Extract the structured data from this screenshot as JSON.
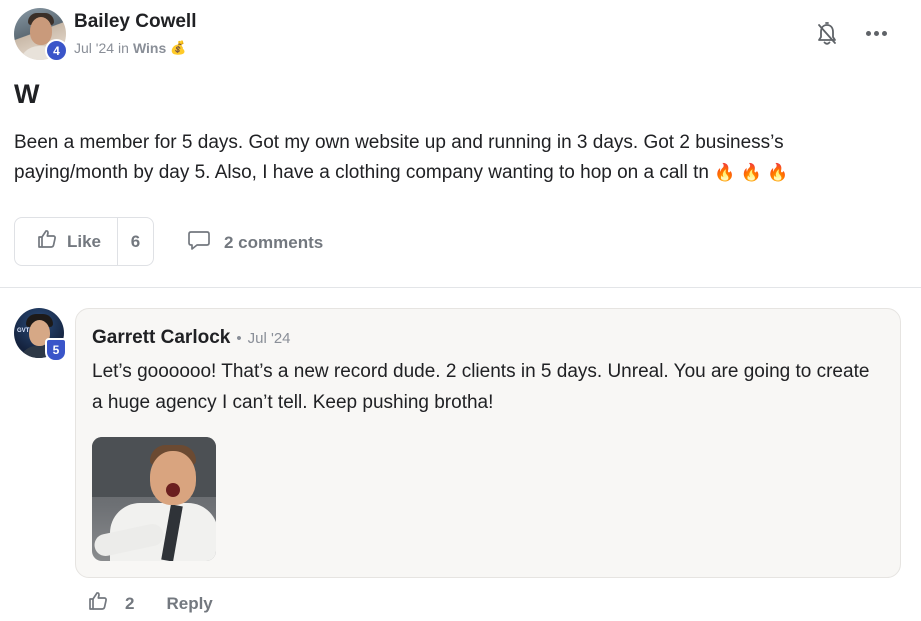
{
  "post": {
    "author": "Bailey Cowell",
    "author_level": "4",
    "date": "Jul '24",
    "in_text": "in",
    "category": "Wins",
    "category_emoji": "💰",
    "title": "W",
    "body": "Been a member for 5 days. Got my own website up and running in 3 days. Got 2 business’s paying/month by day 5. Also, I have a clothing company wanting to hop on a call tn",
    "body_emoji": [
      "🔥",
      "🔥",
      "🔥"
    ],
    "like_label": "Like",
    "like_count": "6",
    "comments_label": "2 comments"
  },
  "comment": {
    "author": "Garrett Carlock",
    "separator": "•",
    "date": "Jul '24",
    "author_level": "5",
    "avatar_tag": "GVT",
    "text": "Let’s goooooo! That’s a new record dude. 2 clients in 5 days. Unreal. You are going to create a huge agency I can’t tell. Keep pushing brotha!",
    "like_count": "2",
    "reply_label": "Reply"
  },
  "icons": {
    "bell": "bell-off-icon",
    "more": "more-horizontal-icon",
    "like": "thumbs-up-icon",
    "comments": "comment-bubble-icon"
  },
  "colors": {
    "level_badge": "#3a55c9",
    "muted_text": "#73787f",
    "card_bg": "#f8f7f5"
  }
}
